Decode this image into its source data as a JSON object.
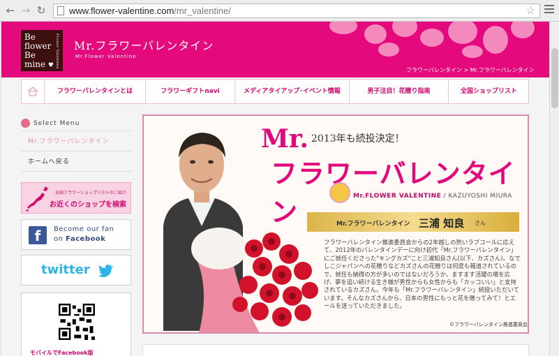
{
  "browser": {
    "url_host": "www.flower-valentine.com",
    "url_path": "/mr_valentine/"
  },
  "header": {
    "logo_lines": [
      "Be",
      "flower",
      "Be",
      "mine"
    ],
    "logo_vertical": "Flower Valentine",
    "title": "Mr.フラワーバレンタイン",
    "subtitle": "Mr.Flower Valentine",
    "breadcrumb": "フラワーバレンタイン > Mr.フラワーバレンタイン"
  },
  "nav": {
    "items": [
      {
        "label": "フラワーバレンタインとは"
      },
      {
        "label": "フラワーギフトnavi"
      },
      {
        "label": "メディアタイアップ･イベント情報"
      },
      {
        "label": "男子注目！花贈り指南"
      },
      {
        "label": "全国ショップリスト"
      }
    ]
  },
  "sidebar": {
    "menu_title": "Select Menu",
    "links": [
      {
        "label": "Mr.フラワーバレンタイン",
        "active": true
      },
      {
        "label": "ホームへ戻る",
        "active": false
      }
    ],
    "shop_banner": {
      "small": "全国フラワーショップリストのご紹介",
      "big": "お近くのショップを検索"
    },
    "facebook": {
      "line1": "Become our fan",
      "line2_prefix": "on ",
      "line2_brand": "Facebook"
    },
    "twitter": {
      "label": "twitter"
    },
    "qr_label": "モバイルでFacebook版"
  },
  "banner": {
    "badge": "2013年も続投決定！",
    "title_line1": "Mr.",
    "title_line2": "フラワーバレンタイン",
    "en_label_brand": "Mr.FLOWER VALENTINE",
    "en_label_rest": " / KAZUYOSHI MIURA",
    "plate_label": "Mr.フラワーバレンタイン",
    "plate_name": "三浦 知良",
    "plate_suffix": "さん",
    "description": "フラワーバレンタイン推進委員会からの2年越しの熱いラブコールに応えて、2012年のバレンタインデーに向け初代「Mr.フラワーバレンタイン」にご就任くださった\"キングカズ\"こと三浦知良さん(以下、カズさん)。なでしこジャパンへの花贈りなどカズさんの花贈りは何度も報道されているので、就任も納得の方が多いのではないだろうか。ますます活躍の場を広げ、夢を追い続ける生き様が男性からも女性からも「カッコいい」と支持されているカズさん。今年も「Mr.フラワーバレンタイン」続投いただいています。そんなカズさんから、日本の男性にもっと花を贈ってみて！とエールを送っていただきました。",
    "copyright": "©フラワーバレンタイン推進委員会"
  },
  "colors": {
    "brand": "#e4097d",
    "nav_text": "#d3066f",
    "facebook": "#3b5998",
    "twitter": "#30b4e8",
    "gold": "#dcb44a"
  }
}
